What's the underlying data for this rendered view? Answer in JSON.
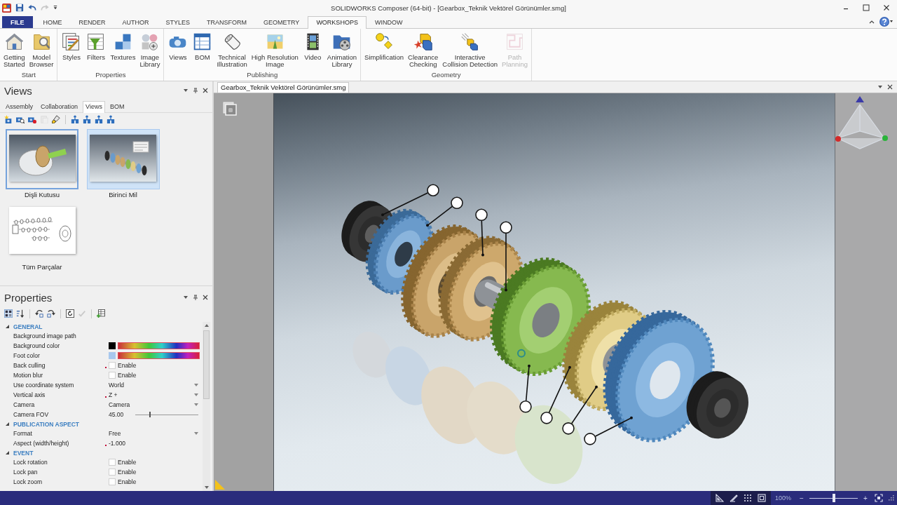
{
  "window": {
    "title": "SOLIDWORKS Composer (64-bit) - [Gearbox_Teknik Vektörel Görünümler.smg]",
    "quick_access": [
      {
        "kind": "save",
        "disabled": false
      },
      {
        "kind": "undo",
        "disabled": false
      },
      {
        "kind": "redo",
        "disabled": true
      },
      {
        "kind": "customize",
        "disabled": false
      }
    ]
  },
  "ribbon": {
    "tabs": [
      {
        "label": "FILE",
        "kind": "file",
        "selected": false
      },
      {
        "label": "HOME",
        "kind": "tab",
        "selected": false
      },
      {
        "label": "RENDER",
        "kind": "tab",
        "selected": false
      },
      {
        "label": "AUTHOR",
        "kind": "tab",
        "selected": false
      },
      {
        "label": "STYLES",
        "kind": "tab",
        "selected": false
      },
      {
        "label": "TRANSFORM",
        "kind": "tab",
        "selected": false
      },
      {
        "label": "GEOMETRY",
        "kind": "tab",
        "selected": false
      },
      {
        "label": "WORKSHOPS",
        "kind": "tab",
        "selected": true
      },
      {
        "label": "WINDOW",
        "kind": "tab",
        "selected": false
      }
    ],
    "groups": [
      {
        "label": "Start",
        "buttons": [
          {
            "label": [
              "Getting",
              "Started"
            ],
            "kind": "house",
            "disabled": false
          },
          {
            "label": [
              "Model",
              "Browser"
            ],
            "kind": "folder",
            "disabled": false
          }
        ]
      },
      {
        "label": "Properties",
        "buttons": [
          {
            "label": [
              "Styles"
            ],
            "kind": "styles",
            "disabled": false
          },
          {
            "label": [
              "Filters"
            ],
            "kind": "filters",
            "disabled": false
          },
          {
            "label": [
              "Textures"
            ],
            "kind": "textures",
            "disabled": false
          },
          {
            "label": [
              "Image",
              "Library"
            ],
            "kind": "image_library",
            "disabled": false
          }
        ]
      },
      {
        "label": "Publishing",
        "buttons": [
          {
            "label": [
              "Views"
            ],
            "kind": "camera",
            "disabled": false
          },
          {
            "label": [
              "BOM"
            ],
            "kind": "table",
            "disabled": false
          },
          {
            "label": [
              "Technical",
              "Illustration"
            ],
            "kind": "cylinder",
            "disabled": false
          },
          {
            "label": [
              "High Resolution",
              "Image"
            ],
            "kind": "picture",
            "disabled": false
          },
          {
            "label": [
              "Video"
            ],
            "kind": "film",
            "disabled": false
          },
          {
            "label": [
              "Animation",
              "Library"
            ],
            "kind": "reel_folder",
            "disabled": false
          }
        ]
      },
      {
        "label": "Geometry",
        "buttons": [
          {
            "label": [
              "Simplification"
            ],
            "kind": "simplify",
            "disabled": false
          },
          {
            "label": [
              "Clearance",
              "Checking"
            ],
            "kind": "cubes",
            "disabled": false
          },
          {
            "label": [
              "Interactive",
              "Collision Detection"
            ],
            "kind": "collision",
            "disabled": false
          },
          {
            "label": [
              "Path",
              "Planning"
            ],
            "kind": "path",
            "disabled": true
          }
        ]
      }
    ]
  },
  "views_panel": {
    "title": "Views",
    "tabs": [
      {
        "label": "Assembly",
        "selected": false
      },
      {
        "label": "Collaboration",
        "selected": false
      },
      {
        "label": "Views",
        "selected": true
      },
      {
        "label": "BOM",
        "selected": false
      }
    ],
    "toolbar": [
      [
        {
          "kind": "new_view",
          "disabled": false
        },
        {
          "kind": "update_view",
          "disabled": false
        },
        {
          "kind": "record_view",
          "disabled": false
        },
        {
          "kind": "paste",
          "disabled": true
        },
        {
          "kind": "brush",
          "disabled": false
        }
      ],
      [
        {
          "kind": "move",
          "disabled": false
        },
        {
          "kind": "move",
          "disabled": false
        },
        {
          "kind": "move",
          "disabled": false
        },
        {
          "kind": "move",
          "disabled": false
        }
      ]
    ],
    "views": [
      {
        "name": "Dişli Kutusu",
        "kind": "gearbox",
        "selected": false,
        "focused": true
      },
      {
        "name": "Birinci Mil",
        "kind": "shaft",
        "selected": true,
        "focused": false
      },
      {
        "name": "Tüm Parçalar",
        "kind": "exploded",
        "selected": false,
        "focused": false
      }
    ]
  },
  "properties_panel": {
    "title": "Properties",
    "toolbar": [
      [
        {
          "kind": "categorized",
          "disabled": false
        },
        {
          "kind": "alphabetical",
          "disabled": false
        }
      ],
      [
        {
          "kind": "expand_all",
          "disabled": false
        },
        {
          "kind": "collapse_all",
          "disabled": false
        }
      ],
      [
        {
          "kind": "reset",
          "disabled": false
        },
        {
          "kind": "apply",
          "disabled": true
        }
      ],
      [
        {
          "kind": "table_add",
          "disabled": false
        }
      ]
    ],
    "sections": [
      {
        "label": "GENERAL",
        "expanded": true,
        "rows": [
          {
            "name": "Background image path",
            "kind": "text",
            "modified": false
          },
          {
            "name": "Background color",
            "kind": "color",
            "modified": false,
            "color": "#000000"
          },
          {
            "name": "Foot color",
            "kind": "color",
            "modified": false,
            "color": "#a8c8ee"
          },
          {
            "name": "Back culling",
            "kind": "checkbox",
            "modified": true,
            "checked": false,
            "value": "Enable"
          },
          {
            "name": "Motion blur",
            "kind": "checkbox",
            "modified": false,
            "checked": false,
            "value": "Enable"
          },
          {
            "name": "Use coordinate system",
            "kind": "dropdown",
            "modified": false,
            "value": "World"
          },
          {
            "name": "Vertical axis",
            "kind": "dropdown",
            "modified": true,
            "value": "Z +"
          },
          {
            "name": "Camera",
            "kind": "dropdown",
            "modified": false,
            "value": "Camera"
          },
          {
            "name": "Camera FOV",
            "kind": "slider",
            "modified": false,
            "value": "45.00",
            "level": 0.23
          }
        ]
      },
      {
        "label": "PUBLICATION ASPECT",
        "expanded": true,
        "rows": [
          {
            "name": "Format",
            "kind": "dropdown",
            "modified": false,
            "value": "Free"
          },
          {
            "name": "Aspect (width/height)",
            "kind": "text",
            "modified": true,
            "value": "-1.000"
          }
        ]
      },
      {
        "label": "EVENT",
        "expanded": true,
        "rows": [
          {
            "name": "Lock rotation",
            "kind": "checkbox",
            "modified": false,
            "checked": false,
            "value": "Enable"
          },
          {
            "name": "Lock pan",
            "kind": "checkbox",
            "modified": false,
            "checked": false,
            "value": "Enable"
          },
          {
            "name": "Lock zoom",
            "kind": "checkbox",
            "modified": false,
            "checked": false,
            "value": "Enable"
          }
        ]
      }
    ]
  },
  "document": {
    "tabs": [
      {
        "label": "Gearbox_Teknik Vektörel Görünümler.smg",
        "selected": true
      }
    ]
  },
  "status_bar": {
    "tools": [
      {
        "kind": "set_square"
      },
      {
        "kind": "angle"
      },
      {
        "kind": "grid"
      },
      {
        "kind": "frame"
      }
    ],
    "zoom": {
      "reading": "100%",
      "minus": "−",
      "plus": "+",
      "level": 0.5
    }
  }
}
